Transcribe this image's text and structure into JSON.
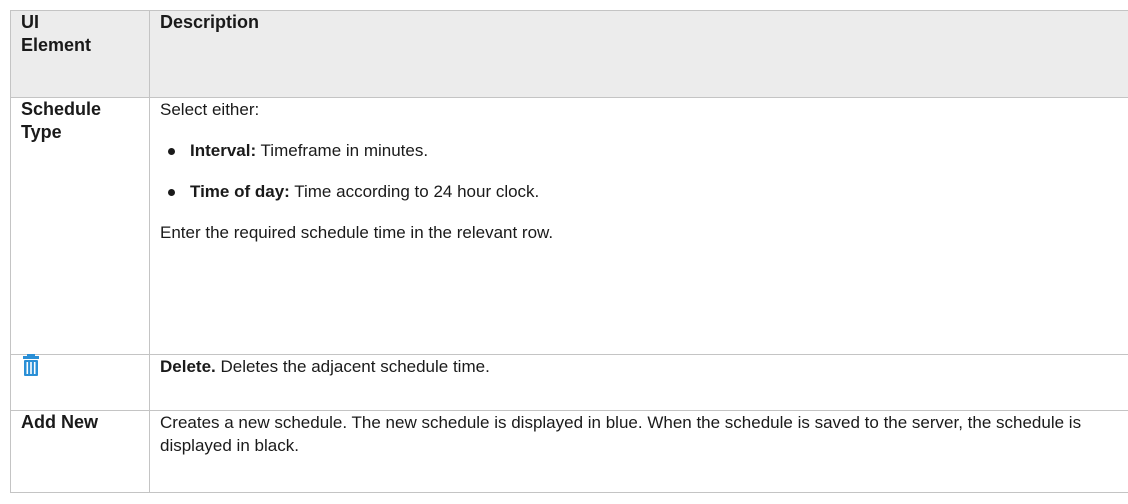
{
  "table": {
    "headers": [
      "UI\nElement",
      "Description"
    ],
    "header_ui": "UI",
    "header_element": "Element",
    "header_description": "Description",
    "rows": [
      {
        "element": "Schedule Type",
        "element_line1": "Schedule",
        "element_line2": "Type",
        "intro": "Select either:",
        "options": [
          {
            "term": "Interval:",
            "text": " Timeframe in minutes."
          },
          {
            "term": "Time of day:",
            "text": " Time according to 24 hour clock."
          }
        ],
        "outro": "Enter the required schedule time in the relevant row."
      },
      {
        "element_icon": "trash-icon",
        "term": "Delete.",
        "text": " Deletes the adjacent schedule time."
      },
      {
        "element": "Add New",
        "text": "Creates a new schedule. The new schedule is displayed in blue. When the schedule is saved to the server, the schedule is displayed in black."
      }
    ]
  },
  "colors": {
    "header_bg": "#ececec",
    "border": "#c4c4c4",
    "icon": "#2a8fd6"
  }
}
